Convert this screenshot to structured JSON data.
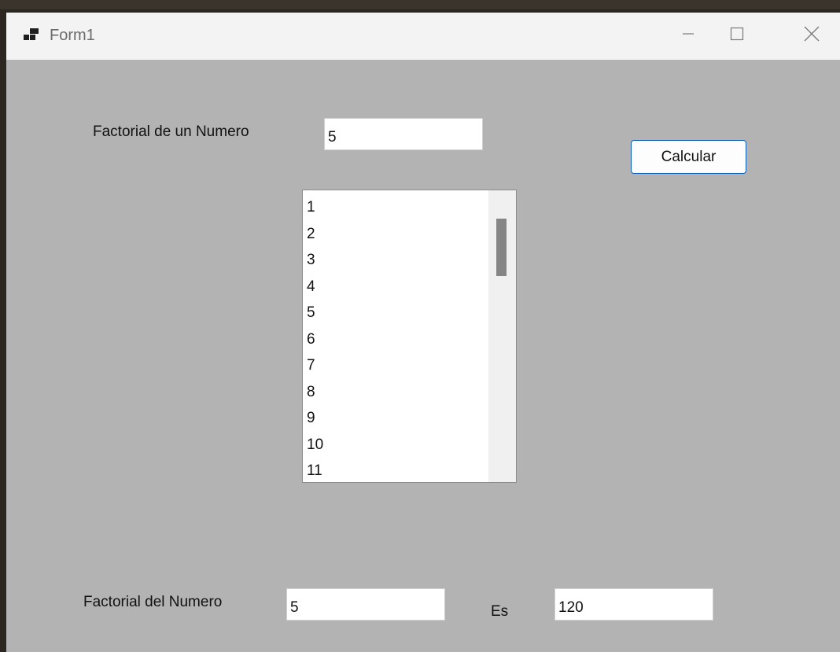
{
  "window": {
    "title": "Form1",
    "minimize_glyph": "—",
    "maximize_glyph": "☐",
    "close_glyph": "✕"
  },
  "form": {
    "input_label": "Factorial de un Numero",
    "input_value": "5",
    "calculate_button": "Calcular",
    "list_items": [
      "1",
      "2",
      "3",
      "4",
      "5",
      "6",
      "7",
      "8",
      "9",
      "10",
      "11"
    ],
    "result_label": "Factorial del Numero",
    "result_number": "5",
    "es_label": "Es",
    "result_value": "120"
  },
  "icons": {
    "app": "windows-form-icon",
    "minimize": "minimize-icon",
    "maximize": "maximize-icon",
    "close": "close-icon"
  },
  "colors": {
    "form_background": "#b3b3b3",
    "titlebar": "#f3f3f3",
    "button_border": "#0a5fb4",
    "scroll_thumb": "#858585"
  }
}
